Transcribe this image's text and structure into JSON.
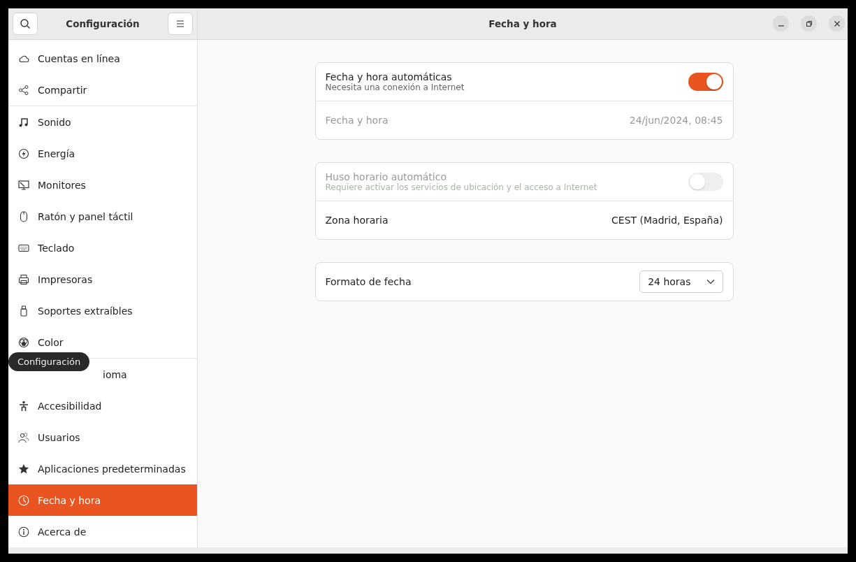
{
  "sidebar": {
    "title": "Configuración",
    "groups": [
      [
        {
          "label": "Cuentas en línea",
          "selected": false
        },
        {
          "label": "Compartir",
          "selected": false
        }
      ],
      [
        {
          "label": "Sonido",
          "selected": false
        },
        {
          "label": "Energía",
          "selected": false
        },
        {
          "label": "Monitores",
          "selected": false
        },
        {
          "label": "Ratón y panel táctil",
          "selected": false
        },
        {
          "label": "Teclado",
          "selected": false
        },
        {
          "label": "Impresoras",
          "selected": false
        },
        {
          "label": "Soportes extraíbles",
          "selected": false
        },
        {
          "label": "Color",
          "selected": false
        }
      ],
      [
        {
          "label": "ioma",
          "selected": false,
          "tooltip": "Configuración"
        },
        {
          "label": "Accesibilidad",
          "selected": false
        },
        {
          "label": "Usuarios",
          "selected": false
        },
        {
          "label": "Aplicaciones predeterminadas",
          "selected": false
        },
        {
          "label": "Fecha y hora",
          "selected": true
        },
        {
          "label": "Acerca de",
          "selected": false
        }
      ]
    ]
  },
  "window": {
    "title": "Fecha y hora"
  },
  "cards": [
    [
      {
        "kind": "switch",
        "label": "Fecha y hora automáticas",
        "subtitle": "Necesita una conexión a Internet",
        "on": true,
        "disabled": false
      },
      {
        "kind": "value",
        "label": "Fecha y hora",
        "value": "24/jun/2024, 08:45",
        "disabled": true
      }
    ],
    [
      {
        "kind": "switch",
        "label": "Huso horario automático",
        "subtitle": "Requiere activar los servicios de ubicación y el acceso a Internet",
        "on": false,
        "disabled": true
      },
      {
        "kind": "value",
        "label": "Zona horaria",
        "value": "CEST (Madrid, España)",
        "disabled": false
      }
    ],
    [
      {
        "kind": "dropdown",
        "label": "Formato de fecha",
        "value": "24 horas",
        "disabled": false
      }
    ]
  ]
}
